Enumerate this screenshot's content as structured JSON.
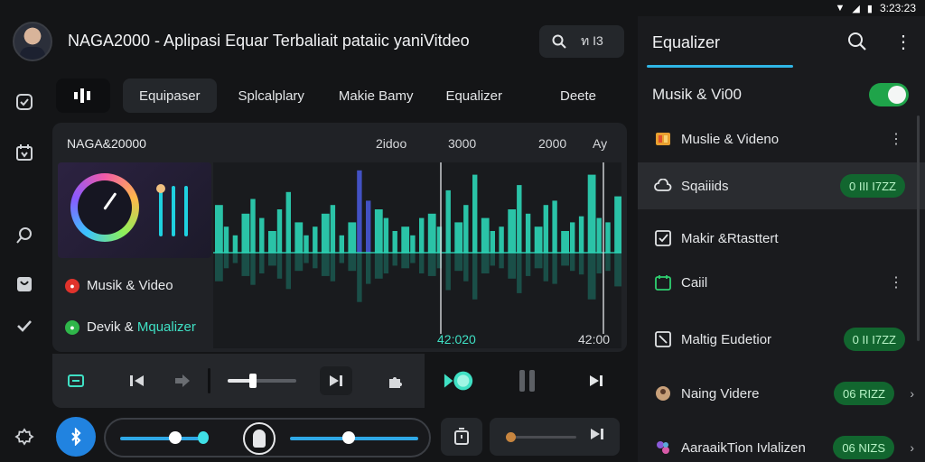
{
  "status_bar": {
    "time": "3:23:23"
  },
  "header": {
    "app_title": "NAGA2000 - Aplipasi Equar Terbaliait pataiic yaniVitdeo",
    "search_text": "ท I3"
  },
  "tabs": [
    {
      "label": "Equipaser"
    },
    {
      "label": "Splcalplary"
    },
    {
      "label": "Makie Bamy"
    },
    {
      "label": "Equalizer"
    },
    {
      "label": "Deete"
    }
  ],
  "card": {
    "title": "NAGA&20000",
    "axis_labels": [
      "2idoo",
      "3000",
      "2000",
      "Ay"
    ],
    "legend": [
      {
        "label": "Musik & Video",
        "color": "#e0332c"
      },
      {
        "label_prefix": "Devik &",
        "label_highlight": "Mqualizer",
        "color": "#2fb64a"
      }
    ],
    "time_current": "42:020",
    "time_total": "42:00",
    "bar_levels": [
      0.55,
      0.3,
      0.2,
      0.45,
      0.62,
      0.4,
      0.25,
      0.5,
      0.7,
      0.35,
      0.2,
      0.3,
      0.45,
      0.55,
      0.2,
      0.35,
      0.95,
      0.6,
      0.5,
      0.4,
      0.25,
      0.3,
      0.2,
      0.4,
      0.45,
      0.3,
      0.72,
      0.35,
      0.55,
      0.9,
      0.4,
      0.25,
      0.3,
      0.5,
      0.78,
      0.45,
      0.3,
      0.55,
      0.6,
      0.25,
      0.35,
      0.42,
      0.9,
      0.4,
      0.35,
      0.65
    ]
  },
  "right_panel": {
    "title": "Equalizer",
    "toggle_label": "Musik & Vi00",
    "items": [
      {
        "label": "Muslie & Videno",
        "icon": "film-icon",
        "badge": "",
        "dots": true
      },
      {
        "label": "Sqaiiids",
        "icon": "cloud-icon",
        "badge": "0 III I7ZZ"
      },
      {
        "label": "Makir &Rtasttert",
        "icon": "checkbox-icon",
        "badge": ""
      },
      {
        "label": "Caiil",
        "icon": "calendar-icon",
        "badge": "",
        "dots": true
      },
      {
        "label": "Maltig Eudetior",
        "icon": "frame-icon",
        "badge": "0 II I7ZZ"
      },
      {
        "label": "Naing Videre",
        "icon": "avatar-icon",
        "badge": "06 RIZZ",
        "chevron": true
      },
      {
        "label": "AaraaikTion Ivlalizen",
        "icon": "mix-icon",
        "badge": "06 NIZS",
        "chevron": true
      }
    ]
  },
  "colors": {
    "accent_teal": "#2ee0c0",
    "accent_blue": "#2183e0",
    "badge_green": "#12662f",
    "toggle_green": "#1fa44a"
  }
}
